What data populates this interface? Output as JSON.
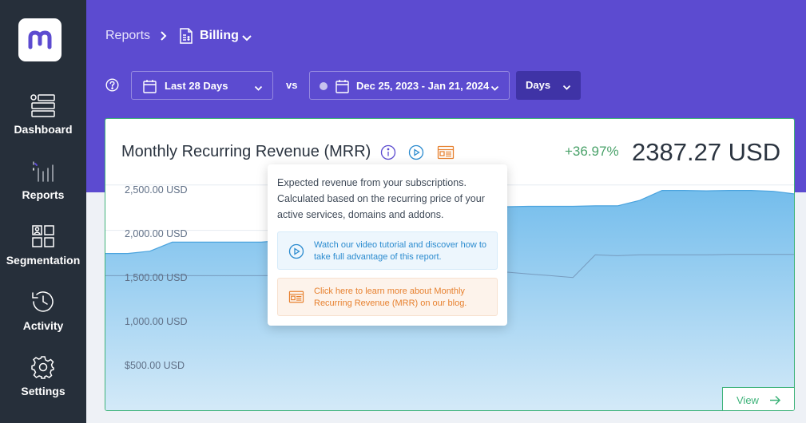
{
  "sidebar": {
    "logo_icon": "brand-m-logo",
    "items": [
      {
        "label": "Dashboard",
        "icon": "dashboard-icon"
      },
      {
        "label": "Reports",
        "icon": "reports-icon"
      },
      {
        "label": "Segmentation",
        "icon": "segmentation-icon"
      },
      {
        "label": "Activity",
        "icon": "activity-icon"
      },
      {
        "label": "Settings",
        "icon": "settings-icon"
      }
    ]
  },
  "breadcrumb": {
    "root": "Reports",
    "current": "Billing"
  },
  "filters": {
    "range_label": "Last 28 Days",
    "vs_label": "vs",
    "compare_range": "Dec 25, 2023 - Jan 21, 2024",
    "granularity": "Days"
  },
  "card": {
    "title": "Monthly Recurring Revenue (MRR)",
    "change": "+36.97%",
    "value": "2387.27 USD",
    "view_label": "View"
  },
  "tooltip": {
    "description": "Expected revenue from your subscriptions. Calculated based on the recurring price of your active services, domains and addons.",
    "video_text": "Watch our video tutorial and discover how to take full advantage of this report.",
    "blog_text": "Click here to learn more about Monthly Recurring Revenue (MRR) on our blog."
  },
  "colors": {
    "sidebar_bg": "#262f3a",
    "header_bg": "#5c4bd0",
    "accent_green": "#3fb37a",
    "area_fill": "#7cc3ee",
    "link_blue": "#2b8bcf",
    "link_orange": "#e7812f"
  },
  "chart_data": {
    "type": "area",
    "y_tick_labels": [
      "2,500.00 USD",
      "2,000.00 USD",
      "1,500.00 USD",
      "1,000.00 USD",
      "$500.00 USD"
    ],
    "y_ticks": [
      2500,
      2000,
      1500,
      1000,
      500
    ],
    "ylim": [
      0,
      2700
    ],
    "grid": true,
    "series": [
      {
        "values": [
          1745,
          1745,
          1770,
          1870,
          1870,
          1870,
          1870,
          1870,
          1890,
          1900,
          1920,
          1950,
          1980,
          2020,
          2080,
          2150,
          2210,
          2230,
          2260,
          2265,
          2265,
          2265,
          2270,
          2270,
          2330,
          2440,
          2440,
          2435,
          2440,
          2440,
          2430,
          2400
        ]
      },
      {
        "values": [
          1500,
          1500,
          1500,
          1500,
          1500,
          1500,
          1500,
          1500,
          1500,
          1500,
          1500,
          1500,
          1500,
          1500,
          1510,
          1520,
          1530,
          1535,
          1540,
          1520,
          1500,
          1480,
          1730,
          1720,
          1730,
          1730,
          1730,
          1730,
          1735,
          1735,
          1735,
          1735
        ]
      }
    ]
  }
}
